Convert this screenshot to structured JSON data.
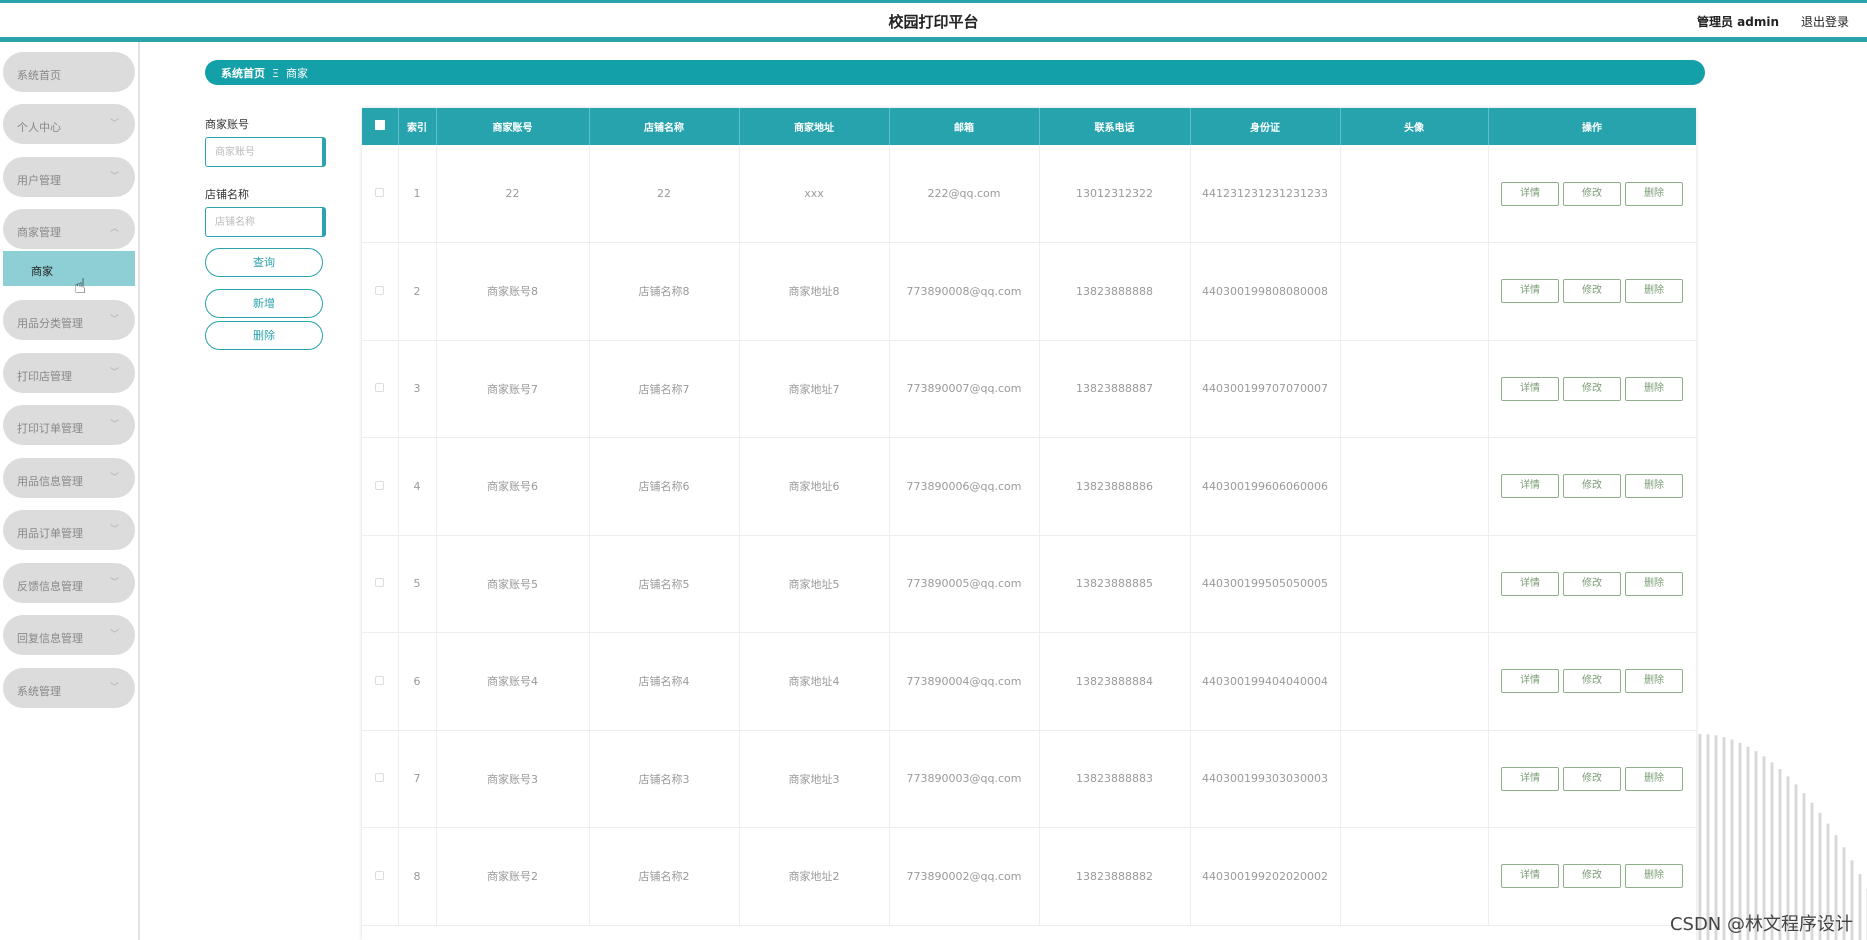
{
  "header": {
    "title": "校园打印平台",
    "user": "管理员 admin",
    "logout": "退出登录"
  },
  "sidebar": {
    "items": [
      {
        "label": "系统首页",
        "chevron": ""
      },
      {
        "label": "个人中心",
        "chevron": "﹀"
      },
      {
        "label": "用户管理",
        "chevron": "﹀"
      },
      {
        "label": "商家管理",
        "chevron": "︿"
      },
      {
        "label": "用品分类管理",
        "chevron": "﹀"
      },
      {
        "label": "打印店管理",
        "chevron": "﹀"
      },
      {
        "label": "打印订单管理",
        "chevron": "﹀"
      },
      {
        "label": "用品信息管理",
        "chevron": "﹀"
      },
      {
        "label": "用品订单管理",
        "chevron": "﹀"
      },
      {
        "label": "反馈信息管理",
        "chevron": "﹀"
      },
      {
        "label": "回复信息管理",
        "chevron": "﹀"
      },
      {
        "label": "系统管理",
        "chevron": "﹀"
      }
    ],
    "sub_active": "商家"
  },
  "breadcrumb": {
    "home": "系统首页",
    "sep": "Ξ",
    "current": "商家"
  },
  "search": {
    "account_label": "商家账号",
    "account_placeholder": "商家账号",
    "shop_label": "店铺名称",
    "shop_placeholder": "店铺名称",
    "query": "查询",
    "add": "新增",
    "delete": "删除"
  },
  "table": {
    "headers": [
      "索引",
      "商家账号",
      "店铺名称",
      "商家地址",
      "邮箱",
      "联系电话",
      "身份证",
      "头像",
      "操作"
    ],
    "rows": [
      {
        "index": "1",
        "account": "22",
        "shop": "22",
        "address": "xxx",
        "email": "222@qq.com",
        "phone": "13012312322",
        "idcard": "441231231231231233"
      },
      {
        "index": "2",
        "account": "商家账号8",
        "shop": "店铺名称8",
        "address": "商家地址8",
        "email": "773890008@qq.com",
        "phone": "13823888888",
        "idcard": "440300199808080008"
      },
      {
        "index": "3",
        "account": "商家账号7",
        "shop": "店铺名称7",
        "address": "商家地址7",
        "email": "773890007@qq.com",
        "phone": "13823888887",
        "idcard": "440300199707070007"
      },
      {
        "index": "4",
        "account": "商家账号6",
        "shop": "店铺名称6",
        "address": "商家地址6",
        "email": "773890006@qq.com",
        "phone": "13823888886",
        "idcard": "440300199606060006"
      },
      {
        "index": "5",
        "account": "商家账号5",
        "shop": "店铺名称5",
        "address": "商家地址5",
        "email": "773890005@qq.com",
        "phone": "13823888885",
        "idcard": "440300199505050005"
      },
      {
        "index": "6",
        "account": "商家账号4",
        "shop": "店铺名称4",
        "address": "商家地址4",
        "email": "773890004@qq.com",
        "phone": "13823888884",
        "idcard": "440300199404040004"
      },
      {
        "index": "7",
        "account": "商家账号3",
        "shop": "店铺名称3",
        "address": "商家地址3",
        "email": "773890003@qq.com",
        "phone": "13823888883",
        "idcard": "440300199303030003"
      },
      {
        "index": "8",
        "account": "商家账号2",
        "shop": "店铺名称2",
        "address": "商家地址2",
        "email": "773890002@qq.com",
        "phone": "13823888882",
        "idcard": "440300199202020002"
      }
    ],
    "ops": {
      "detail": "详情",
      "edit": "修改",
      "delete": "删除"
    }
  },
  "watermark": "CSDN @林文程序设计",
  "colors": {
    "accent": "#2aa3ad",
    "breadcrumb": "#14a0a8",
    "active_sub": "#8ecfd6",
    "op_button": "#7a9d74"
  }
}
